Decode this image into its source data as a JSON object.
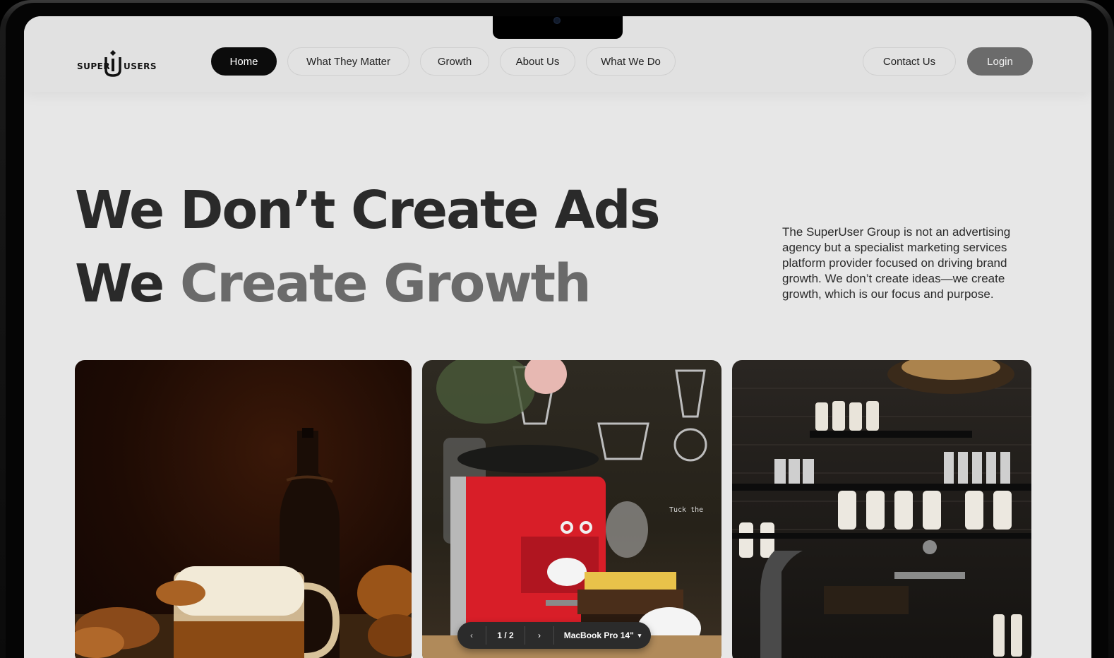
{
  "logo": {
    "left_word": "SUPER",
    "right_word": "USERS"
  },
  "nav": {
    "items": [
      {
        "label": "Home",
        "active": true
      },
      {
        "label": "What They Matter"
      },
      {
        "label": "Growth"
      },
      {
        "label": "About Us"
      },
      {
        "label": "What We Do"
      }
    ],
    "contact_label": "Contact Us",
    "login_label": "Login"
  },
  "hero": {
    "line1": "We Don’t Create Ads",
    "line2_start": "We",
    "line2_accent": "Create Growth",
    "description": "The SuperUser Group is not an advertising agency but a specialist marketing services platform provider focused on driving brand growth. We don’t create ideas—we create growth, which is our focus and purpose."
  },
  "gallery": [
    {
      "subject": "beer mug, bottle and pretzels"
    },
    {
      "subject": "red espresso machine in cafe"
    },
    {
      "subject": "bar shelves with bottles and tap"
    }
  ],
  "preview_toolbar": {
    "page": "1 / 2",
    "device": "MacBook Pro 14\""
  },
  "colors": {
    "background": "#e7e7e7",
    "nav_active": "#0c0c0c",
    "login": "#6b6b6b",
    "text_dark": "#2a2a2a",
    "text_muted": "#6a6a6a"
  }
}
